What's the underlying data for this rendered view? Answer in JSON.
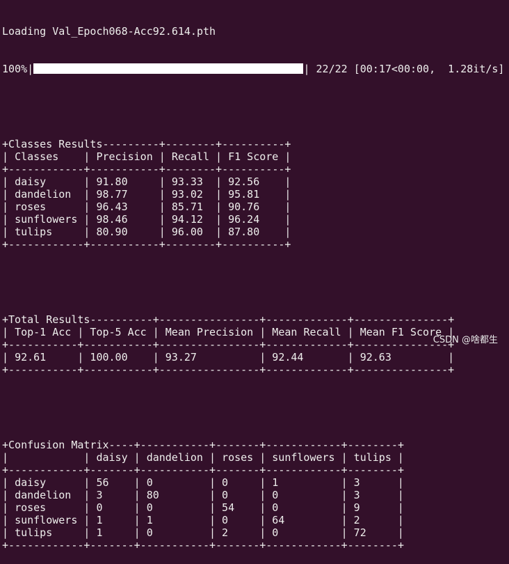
{
  "colors": {
    "background": "#33102a",
    "text": "#eeeeec",
    "progress_bar": "#ffffff"
  },
  "loading": "Loading Val_Epoch068-Acc92.614.pth",
  "progress": {
    "percent_label": "100%",
    "percent": 100,
    "count": "22/22",
    "timing": "[00:17<00:00,  1.28it/s]"
  },
  "classes_table": {
    "title": "Classes Results",
    "headers": [
      "Classes",
      "Precision",
      "Recall",
      "F1 Score"
    ],
    "rows": [
      [
        "daisy",
        "91.80",
        "93.33",
        "92.56"
      ],
      [
        "dandelion",
        "98.77",
        "93.02",
        "95.81"
      ],
      [
        "roses",
        "96.43",
        "85.71",
        "90.76"
      ],
      [
        "sunflowers",
        "98.46",
        "94.12",
        "96.24"
      ],
      [
        "tulips",
        "80.90",
        "96.00",
        "87.80"
      ]
    ]
  },
  "total_table": {
    "title": "Total Results",
    "headers": [
      "Top-1 Acc",
      "Top-5 Acc",
      "Mean Precision",
      "Mean Recall",
      "Mean F1 Score"
    ],
    "rows": [
      [
        "92.61",
        "100.00",
        "93.27",
        "92.44",
        "92.63"
      ]
    ]
  },
  "confusion_table": {
    "title": "Confusion Matrix",
    "headers": [
      "",
      "daisy",
      "dandelion",
      "roses",
      "sunflowers",
      "tulips"
    ],
    "rows": [
      [
        "daisy",
        "56",
        "0",
        "0",
        "1",
        "3"
      ],
      [
        "dandelion",
        "3",
        "80",
        "0",
        "0",
        "3"
      ],
      [
        "roses",
        "0",
        "0",
        "54",
        "0",
        "9"
      ],
      [
        "sunflowers",
        "1",
        "1",
        "0",
        "64",
        "2"
      ],
      [
        "tulips",
        "1",
        "0",
        "2",
        "0",
        "72"
      ]
    ]
  },
  "watermark": "CSDN @啥都生"
}
